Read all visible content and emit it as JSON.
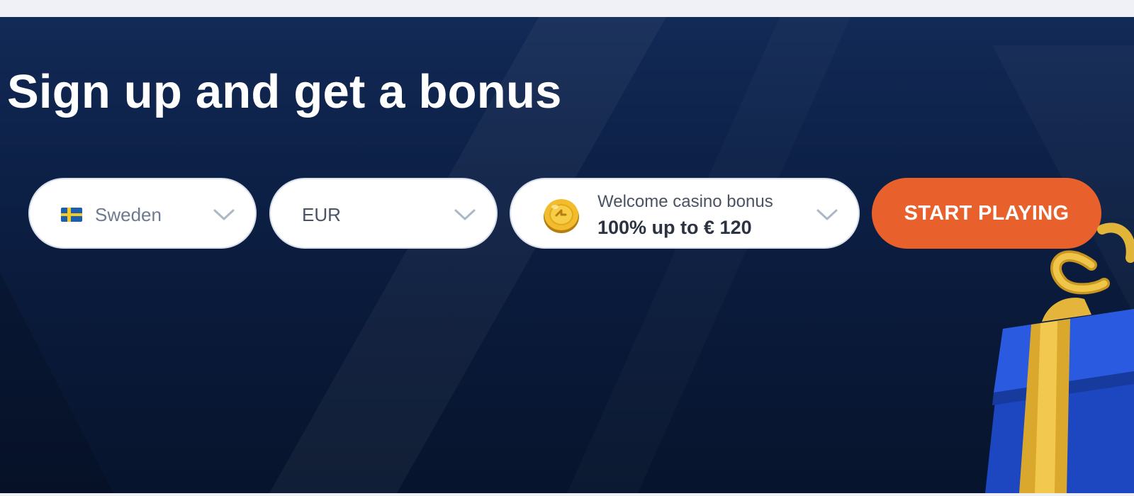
{
  "hero": {
    "title": "Sign up and get a bonus"
  },
  "form": {
    "country": {
      "selected": "Sweden",
      "flag_icon": "sweden-flag-icon"
    },
    "currency": {
      "selected": "EUR"
    },
    "bonus": {
      "label": "Welcome casino bonus",
      "value": "100% up to € 120",
      "icon": "coin-icon"
    },
    "cta_label": "START PLAYING"
  },
  "colors": {
    "cta": "#e8602c",
    "banner_bg": "#0d2148",
    "gift_box": "#2152d4",
    "gift_ribbon": "#e1b43a"
  }
}
